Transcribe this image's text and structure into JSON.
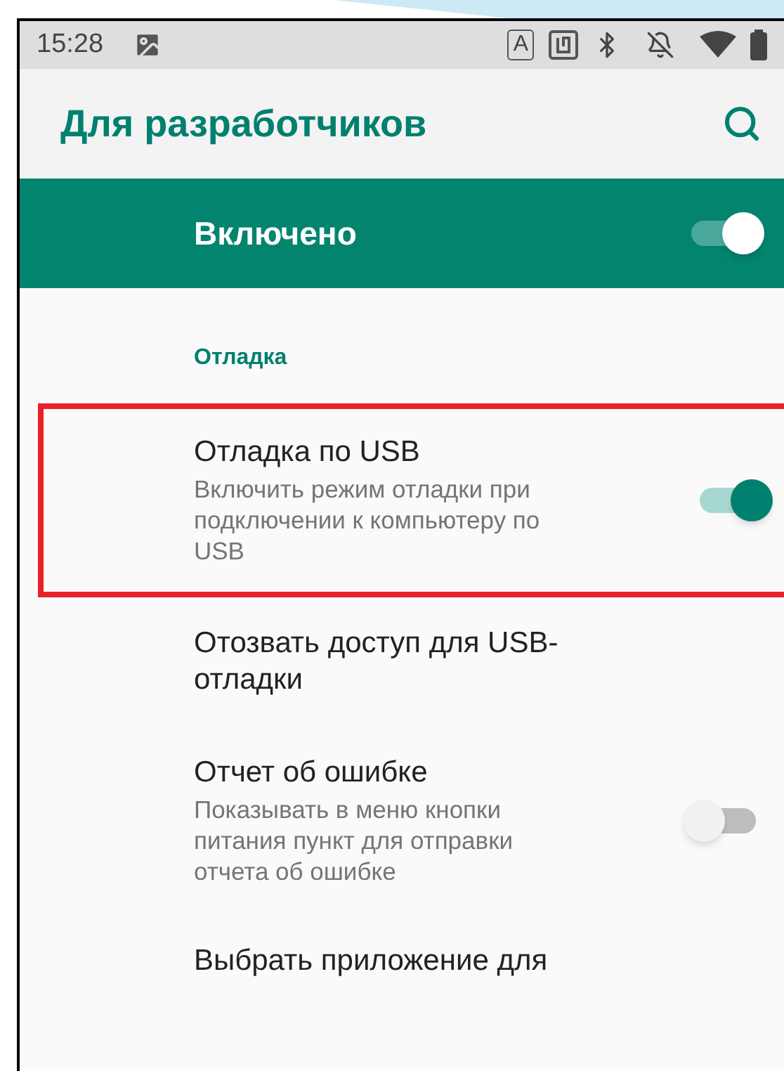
{
  "status_bar": {
    "time": "15:28",
    "input_badge": "A"
  },
  "app_bar": {
    "title": "Для разработчиков"
  },
  "master_switch": {
    "label": "Включено",
    "on": true
  },
  "section": {
    "title": "Отладка"
  },
  "items": [
    {
      "kind": "switch",
      "title": "Отладка по USB",
      "summary": "Включить режим отладки при подключении к компьютеру по USB",
      "on": true,
      "highlighted": true
    },
    {
      "kind": "plain",
      "title": "Отозвать доступ для USB-отладки",
      "highlighted": false
    },
    {
      "kind": "switch",
      "title": "Отчет об ошибке",
      "summary": "Показывать в меню кнопки питания пункт для отправки отчета об ошибке",
      "on": false,
      "highlighted": false
    },
    {
      "kind": "plain",
      "title": "Выбрать приложение для",
      "highlighted": false
    }
  ]
}
